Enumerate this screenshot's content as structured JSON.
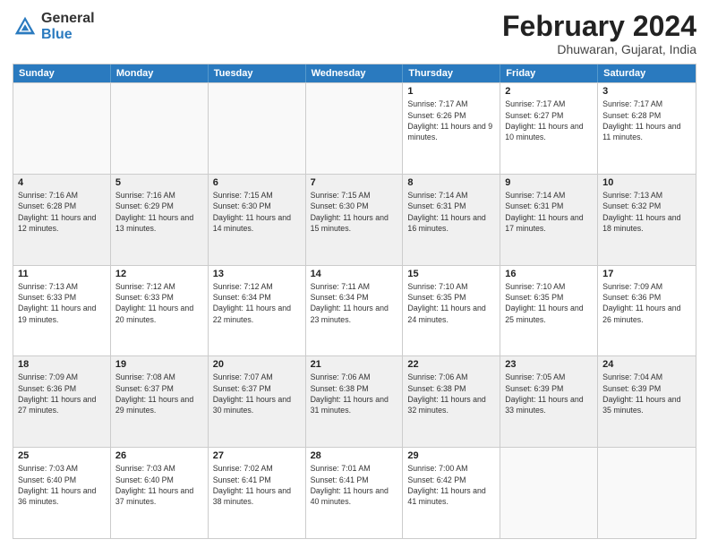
{
  "header": {
    "logo_general": "General",
    "logo_blue": "Blue",
    "title": "February 2024",
    "subtitle": "Dhuwaran, Gujarat, India"
  },
  "days_of_week": [
    "Sunday",
    "Monday",
    "Tuesday",
    "Wednesday",
    "Thursday",
    "Friday",
    "Saturday"
  ],
  "rows": [
    [
      {
        "day": "",
        "info": "",
        "empty": true
      },
      {
        "day": "",
        "info": "",
        "empty": true
      },
      {
        "day": "",
        "info": "",
        "empty": true
      },
      {
        "day": "",
        "info": "",
        "empty": true
      },
      {
        "day": "1",
        "info": "Sunrise: 7:17 AM\nSunset: 6:26 PM\nDaylight: 11 hours\nand 9 minutes."
      },
      {
        "day": "2",
        "info": "Sunrise: 7:17 AM\nSunset: 6:27 PM\nDaylight: 11 hours\nand 10 minutes."
      },
      {
        "day": "3",
        "info": "Sunrise: 7:17 AM\nSunset: 6:28 PM\nDaylight: 11 hours\nand 11 minutes."
      }
    ],
    [
      {
        "day": "4",
        "info": "Sunrise: 7:16 AM\nSunset: 6:28 PM\nDaylight: 11 hours\nand 12 minutes.",
        "shaded": true
      },
      {
        "day": "5",
        "info": "Sunrise: 7:16 AM\nSunset: 6:29 PM\nDaylight: 11 hours\nand 13 minutes.",
        "shaded": true
      },
      {
        "day": "6",
        "info": "Sunrise: 7:15 AM\nSunset: 6:30 PM\nDaylight: 11 hours\nand 14 minutes.",
        "shaded": true
      },
      {
        "day": "7",
        "info": "Sunrise: 7:15 AM\nSunset: 6:30 PM\nDaylight: 11 hours\nand 15 minutes.",
        "shaded": true
      },
      {
        "day": "8",
        "info": "Sunrise: 7:14 AM\nSunset: 6:31 PM\nDaylight: 11 hours\nand 16 minutes.",
        "shaded": true
      },
      {
        "day": "9",
        "info": "Sunrise: 7:14 AM\nSunset: 6:31 PM\nDaylight: 11 hours\nand 17 minutes.",
        "shaded": true
      },
      {
        "day": "10",
        "info": "Sunrise: 7:13 AM\nSunset: 6:32 PM\nDaylight: 11 hours\nand 18 minutes.",
        "shaded": true
      }
    ],
    [
      {
        "day": "11",
        "info": "Sunrise: 7:13 AM\nSunset: 6:33 PM\nDaylight: 11 hours\nand 19 minutes."
      },
      {
        "day": "12",
        "info": "Sunrise: 7:12 AM\nSunset: 6:33 PM\nDaylight: 11 hours\nand 20 minutes."
      },
      {
        "day": "13",
        "info": "Sunrise: 7:12 AM\nSunset: 6:34 PM\nDaylight: 11 hours\nand 22 minutes."
      },
      {
        "day": "14",
        "info": "Sunrise: 7:11 AM\nSunset: 6:34 PM\nDaylight: 11 hours\nand 23 minutes."
      },
      {
        "day": "15",
        "info": "Sunrise: 7:10 AM\nSunset: 6:35 PM\nDaylight: 11 hours\nand 24 minutes."
      },
      {
        "day": "16",
        "info": "Sunrise: 7:10 AM\nSunset: 6:35 PM\nDaylight: 11 hours\nand 25 minutes."
      },
      {
        "day": "17",
        "info": "Sunrise: 7:09 AM\nSunset: 6:36 PM\nDaylight: 11 hours\nand 26 minutes."
      }
    ],
    [
      {
        "day": "18",
        "info": "Sunrise: 7:09 AM\nSunset: 6:36 PM\nDaylight: 11 hours\nand 27 minutes.",
        "shaded": true
      },
      {
        "day": "19",
        "info": "Sunrise: 7:08 AM\nSunset: 6:37 PM\nDaylight: 11 hours\nand 29 minutes.",
        "shaded": true
      },
      {
        "day": "20",
        "info": "Sunrise: 7:07 AM\nSunset: 6:37 PM\nDaylight: 11 hours\nand 30 minutes.",
        "shaded": true
      },
      {
        "day": "21",
        "info": "Sunrise: 7:06 AM\nSunset: 6:38 PM\nDaylight: 11 hours\nand 31 minutes.",
        "shaded": true
      },
      {
        "day": "22",
        "info": "Sunrise: 7:06 AM\nSunset: 6:38 PM\nDaylight: 11 hours\nand 32 minutes.",
        "shaded": true
      },
      {
        "day": "23",
        "info": "Sunrise: 7:05 AM\nSunset: 6:39 PM\nDaylight: 11 hours\nand 33 minutes.",
        "shaded": true
      },
      {
        "day": "24",
        "info": "Sunrise: 7:04 AM\nSunset: 6:39 PM\nDaylight: 11 hours\nand 35 minutes.",
        "shaded": true
      }
    ],
    [
      {
        "day": "25",
        "info": "Sunrise: 7:03 AM\nSunset: 6:40 PM\nDaylight: 11 hours\nand 36 minutes."
      },
      {
        "day": "26",
        "info": "Sunrise: 7:03 AM\nSunset: 6:40 PM\nDaylight: 11 hours\nand 37 minutes."
      },
      {
        "day": "27",
        "info": "Sunrise: 7:02 AM\nSunset: 6:41 PM\nDaylight: 11 hours\nand 38 minutes."
      },
      {
        "day": "28",
        "info": "Sunrise: 7:01 AM\nSunset: 6:41 PM\nDaylight: 11 hours\nand 40 minutes."
      },
      {
        "day": "29",
        "info": "Sunrise: 7:00 AM\nSunset: 6:42 PM\nDaylight: 11 hours\nand 41 minutes."
      },
      {
        "day": "",
        "info": "",
        "empty": true
      },
      {
        "day": "",
        "info": "",
        "empty": true
      }
    ]
  ]
}
